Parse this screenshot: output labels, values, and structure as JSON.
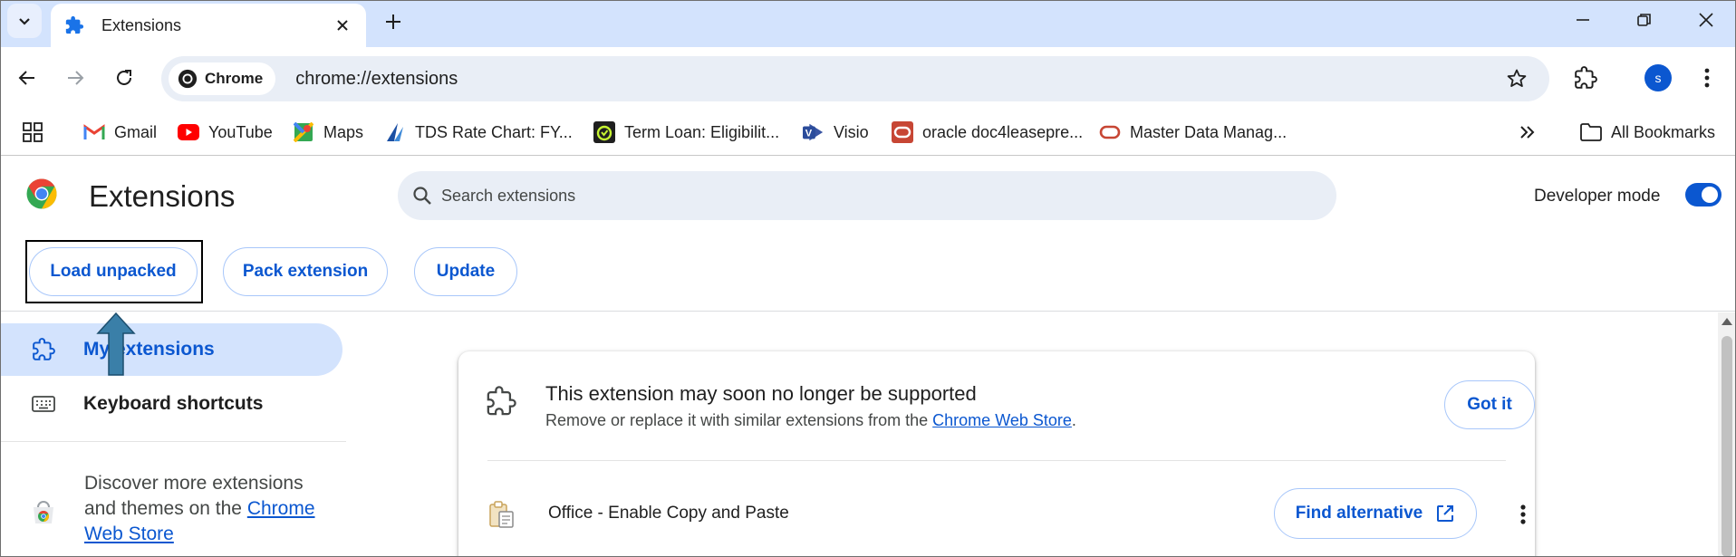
{
  "browser": {
    "tab": {
      "title": "Extensions"
    },
    "address": {
      "chip_label": "Chrome",
      "url": "chrome://extensions"
    },
    "profile_initial": "s"
  },
  "bookmarks": {
    "items": [
      {
        "label": "Gmail"
      },
      {
        "label": "YouTube"
      },
      {
        "label": "Maps"
      },
      {
        "label": "TDS Rate Chart: FY..."
      },
      {
        "label": "Term Loan: Eligibilit..."
      },
      {
        "label": "Visio"
      },
      {
        "label": "oracle doc4leasepre..."
      },
      {
        "label": "Master Data Manag..."
      }
    ],
    "all_bookmarks": "All Bookmarks"
  },
  "header": {
    "title": "Extensions",
    "search_placeholder": "Search extensions",
    "developer_mode_label": "Developer mode",
    "developer_mode_on": true,
    "buttons": {
      "load_unpacked": "Load unpacked",
      "pack_extension": "Pack extension",
      "update": "Update"
    }
  },
  "sidebar": {
    "items": [
      {
        "label": "My extensions",
        "active": true
      },
      {
        "label": "Keyboard shortcuts",
        "active": false
      }
    ],
    "discover_text": "Discover more extensions and themes on the",
    "discover_link": "Chrome Web Store"
  },
  "card": {
    "warning_title": "This extension may soon no longer be supported",
    "warning_sub": "Remove or replace it with similar extensions from the",
    "warning_link": "Chrome Web Store",
    "warning_period": ".",
    "got_it": "Got it",
    "extension_name": "Office - Enable Copy and Paste",
    "find_alternative": "Find alternative"
  },
  "colors": {
    "accent": "#0b57d0",
    "tabstrip": "#d3e3fd",
    "omnibox": "#e9eef6"
  }
}
